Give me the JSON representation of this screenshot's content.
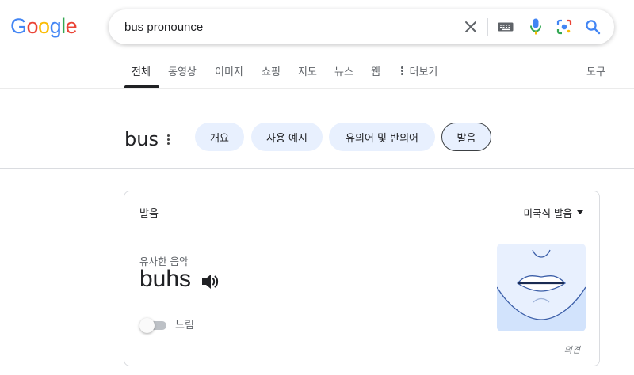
{
  "logo": {
    "text": "Google"
  },
  "search": {
    "query": "bus pronounce"
  },
  "tabs": [
    {
      "label": "전체",
      "active": true
    },
    {
      "label": "동영상"
    },
    {
      "label": "이미지"
    },
    {
      "label": "쇼핑"
    },
    {
      "label": "지도"
    },
    {
      "label": "뉴스"
    },
    {
      "label": "웹"
    },
    {
      "label": "더보기"
    }
  ],
  "tools_label": "도구",
  "topic": {
    "word": "bus",
    "chips": [
      {
        "label": "개요"
      },
      {
        "label": "사용 예시"
      },
      {
        "label": "유의어 및 반의어"
      },
      {
        "label": "발음",
        "selected": true
      }
    ]
  },
  "card": {
    "title": "발음",
    "accent": "미국식 발음",
    "sounds_like_label": "유사한 음악",
    "phonetic": "buhs",
    "slow_label": "느림",
    "slow_enabled": false,
    "feedback": "의견"
  },
  "colors": {
    "accent_blue": "#4285f4",
    "chip_bg": "#e8f0fe",
    "mouth_outline": "#3b5ea8"
  },
  "icons": [
    "clear-icon",
    "keyboard-icon",
    "mic-icon",
    "lens-icon",
    "search-icon",
    "more-vert-icon",
    "speaker-icon",
    "caret-down-icon"
  ]
}
